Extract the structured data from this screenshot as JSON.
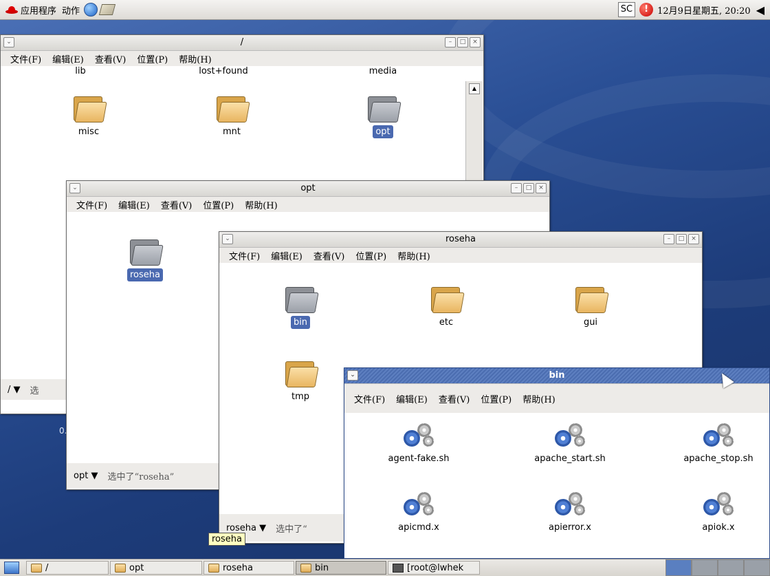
{
  "top_panel": {
    "applications": "应用程序",
    "actions": "动作",
    "input_method": "SC",
    "alert": "!",
    "datetime": "12月9日星期五, 20:20"
  },
  "menu": {
    "file": "文件(F)",
    "edit": "编辑(E)",
    "view": "查看(V)",
    "go": "位置(P)",
    "help": "帮助(H)"
  },
  "windows": {
    "root": {
      "title": "/",
      "items": [
        "lib",
        "lost+found",
        "media",
        "misc",
        "mnt",
        "opt"
      ],
      "status_path": "/",
      "status_info": "选"
    },
    "opt": {
      "title": "opt",
      "items": [
        "roseha"
      ],
      "status_path": "opt",
      "status_info": "选中了“roseha”"
    },
    "roseha": {
      "title": "roseha",
      "items": [
        "bin",
        "etc",
        "gui",
        "tmp"
      ],
      "status_path": "roseha",
      "status_info": "选中了“"
    },
    "bin": {
      "title": "bin",
      "items": [
        "agent-fake.sh",
        "apache_start.sh",
        "apache_stop.sh",
        "apicmd.x",
        "apierror.x",
        "apiok.x"
      ]
    }
  },
  "tooltip": "roseha",
  "desktop_label": "0.",
  "taskbar": {
    "items": [
      "/",
      "opt",
      "roseha",
      "bin",
      "[root@lwhek"
    ]
  },
  "colors": {
    "selection": "#4a69b0",
    "active_title": "#4b6db0",
    "folder": "#e8b560"
  }
}
